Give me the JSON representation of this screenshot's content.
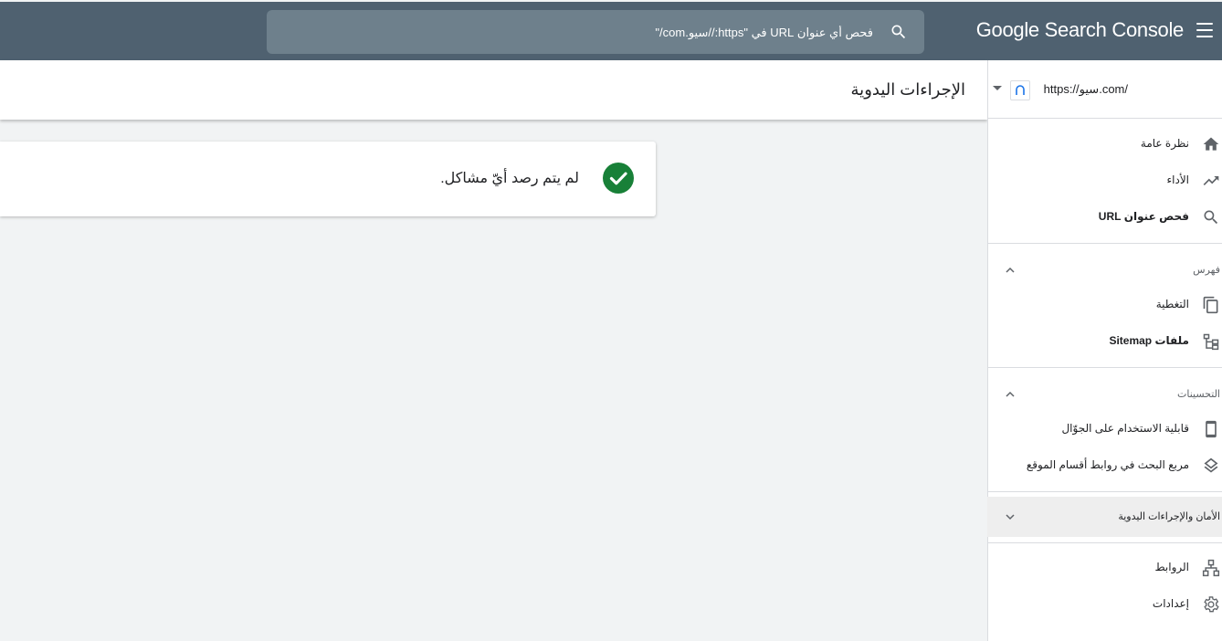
{
  "app": {
    "title": "Google Search Console",
    "icons": {
      "menu": "hamburger-menu-icon",
      "search": "search-icon"
    }
  },
  "search": {
    "placeholder": "فحص أي عنوان URL في \"https://سيو.com/\""
  },
  "property": {
    "url": "https://سيو.com/",
    "icon": "property-globe-icon"
  },
  "page": {
    "title": "الإجراءات اليدوية"
  },
  "status": {
    "message": "لم يتم رصد أيّ مشاكل.",
    "icon": "check-circle-icon",
    "color": "#188038"
  },
  "sidebar": {
    "overview": "نظرة عامة",
    "performance": "الأداء",
    "url_inspection": "فحص عنوان URL",
    "index_section": "فهرس",
    "coverage": "التغطية",
    "sitemaps": "ملفات Sitemap",
    "enhancements_section": "التحسينات",
    "mobile_usability": "قابلية الاستخدام على الجوّال",
    "sitelinks_searchbox": "مربع البحث في روابط أقسام الموقع",
    "security_section": "الأمان والإجراءات اليدوية",
    "links": "الروابط",
    "settings": "إعدادات"
  },
  "colors": {
    "topbar": "#4f6170",
    "search_bg": "#6e808c",
    "main_bg": "#f1f3f4",
    "check": "#188038"
  }
}
